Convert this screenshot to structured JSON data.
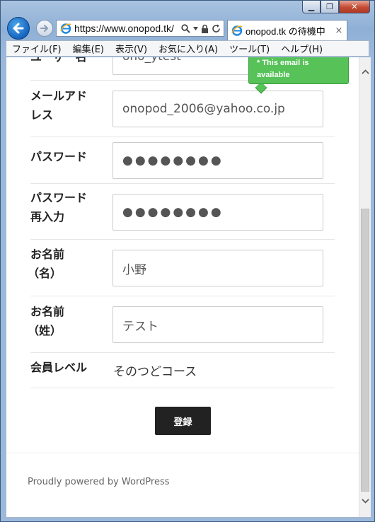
{
  "window": {
    "minimize_glyph": "▁",
    "restore_glyph": "❐",
    "close_glyph": "✕"
  },
  "nav": {
    "url": "https://www.onopod.tk/",
    "tab_title": "onopod.tk の待機中",
    "tab_close": "×"
  },
  "menu": {
    "items": [
      {
        "label": "ファイル(F)"
      },
      {
        "label": "編集(E)"
      },
      {
        "label": "表示(V)"
      },
      {
        "label": "お気に入り(A)"
      },
      {
        "label": "ツール(T)"
      },
      {
        "label": "ヘルプ(H)"
      }
    ]
  },
  "form": {
    "username": {
      "label": "ユーザー名",
      "value": "ono_ytest"
    },
    "email": {
      "label_line1": "メールアド",
      "label_line2": "レス",
      "value": "onopod_2006@yahoo.co.jp"
    },
    "password": {
      "label": "パスワード",
      "value": "●●●●●●●●"
    },
    "password_confirm": {
      "label_line1": "パスワード",
      "label_line2": "再入力",
      "value": "●●●●●●●●"
    },
    "first_name": {
      "label_line1": "お名前",
      "label_line2": "（名）",
      "value": "小野"
    },
    "last_name": {
      "label_line1": "お名前",
      "label_line2": "（姓）",
      "value": "テスト"
    },
    "member_level": {
      "label": "会員レベル",
      "value": "そのつどコース"
    },
    "submit_label": "登録"
  },
  "tooltip": {
    "line1": "* This email is",
    "line2": "available",
    "color": "#56c258"
  },
  "footer": {
    "text": "Proudly powered by WordPress"
  }
}
